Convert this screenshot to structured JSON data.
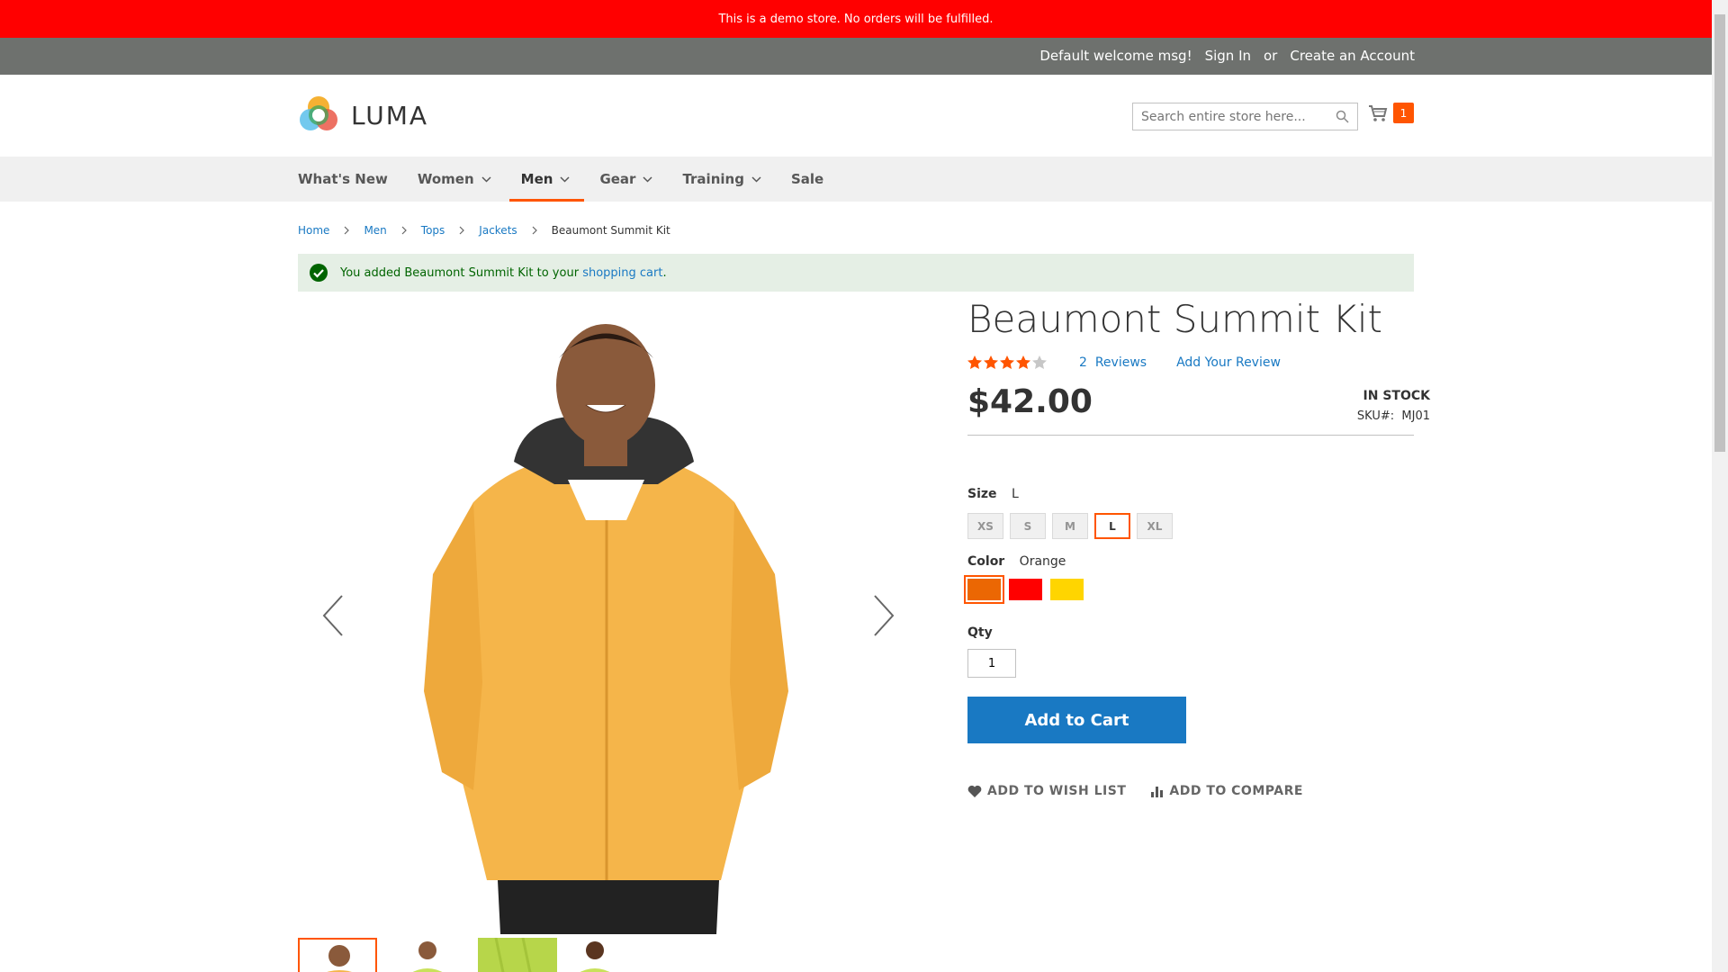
{
  "demo_notice": "This is a demo store. No orders will be fulfilled.",
  "header_panel": {
    "welcome": "Default welcome msg!",
    "sign_in": "Sign In",
    "or": "or",
    "create_account": "Create an Account"
  },
  "logo": {
    "text": "LUMA"
  },
  "search": {
    "placeholder": "Search entire store here..."
  },
  "minicart": {
    "count": "1"
  },
  "nav": {
    "items": [
      {
        "label": "What's New",
        "has_children": false
      },
      {
        "label": "Women",
        "has_children": true
      },
      {
        "label": "Men",
        "has_children": true,
        "active": true
      },
      {
        "label": "Gear",
        "has_children": true
      },
      {
        "label": "Training",
        "has_children": true
      },
      {
        "label": "Sale",
        "has_children": false
      }
    ]
  },
  "breadcrumbs": {
    "items": [
      "Home",
      "Men",
      "Tops",
      "Jackets"
    ],
    "current": "Beaumont Summit Kit"
  },
  "message": {
    "prefix": "You added Beaumont Summit Kit to your",
    "link": "shopping cart",
    "suffix": "."
  },
  "product": {
    "title": "Beaumont Summit Kit",
    "rating_stars": 4.5,
    "reviews_count": "2",
    "reviews_label": "Reviews",
    "add_review": "Add Your Review",
    "price": "$42.00",
    "stock": "IN STOCK",
    "sku_label": "SKU#:",
    "sku": "MJ01",
    "size_label": "Size",
    "size_selected": "L",
    "sizes": [
      "XS",
      "S",
      "M",
      "L",
      "XL"
    ],
    "color_label": "Color",
    "color_selected": "Orange",
    "colors": [
      {
        "name": "Orange",
        "hex": "#eb6703"
      },
      {
        "name": "Red",
        "hex": "#ff0000"
      },
      {
        "name": "Yellow",
        "hex": "#ffd500"
      }
    ],
    "qty_label": "Qty",
    "qty_value": "1",
    "add_to_cart": "Add to Cart",
    "add_to_wishlist": "ADD TO WISH LIST",
    "add_to_compare": "ADD TO COMPARE"
  },
  "colors": {
    "demo_bar": "#ff0000",
    "accent": "#ff5501",
    "link": "#1979c3",
    "jacket": "#f5b54a"
  },
  "icons": [
    "search-icon",
    "cart-icon",
    "chevron-down-icon",
    "chevron-right-icon",
    "check-icon",
    "star-icon",
    "arrow-left-icon",
    "arrow-right-icon",
    "heart-icon",
    "compare-icon"
  ]
}
